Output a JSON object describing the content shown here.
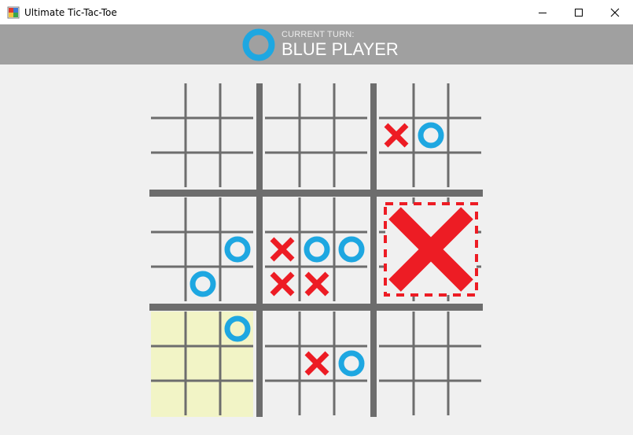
{
  "window": {
    "title": "Ultimate Tic-Tac-Toe",
    "icons": [
      "app-icon",
      "minimize-icon",
      "maximize-icon",
      "close-icon"
    ]
  },
  "turn": {
    "label": "CURRENT TURN:",
    "player": "BLUE PLAYER",
    "symbol": "O"
  },
  "colors": {
    "x": "#ed1c24",
    "o": "#1ea7e1",
    "grid": "#6d6d6d",
    "active_board": "#f2f4c6",
    "banner": "#a0a0a0"
  },
  "board": {
    "active_subboard": 6,
    "won_subboards": {
      "5": "X"
    },
    "subboards": [
      [
        "",
        "",
        "",
        "",
        "",
        "",
        "",
        "",
        ""
      ],
      [
        "",
        "",
        "",
        "",
        "",
        "",
        "",
        "",
        ""
      ],
      [
        "",
        "",
        "",
        "X",
        "O",
        "",
        "",
        "",
        ""
      ],
      [
        "",
        "",
        "",
        "",
        "",
        "O",
        "",
        "O",
        ""
      ],
      [
        "",
        "",
        "",
        "X",
        "O",
        "O",
        "X",
        "X",
        ""
      ],
      [
        "",
        "",
        "",
        "",
        "",
        "",
        "",
        "",
        ""
      ],
      [
        "",
        "",
        "O",
        "",
        "",
        "",
        "",
        "",
        ""
      ],
      [
        "",
        "",
        "",
        "",
        "X",
        "O",
        "",
        "",
        ""
      ],
      [
        "",
        "",
        "",
        "",
        "",
        "",
        "",
        "",
        ""
      ]
    ]
  }
}
